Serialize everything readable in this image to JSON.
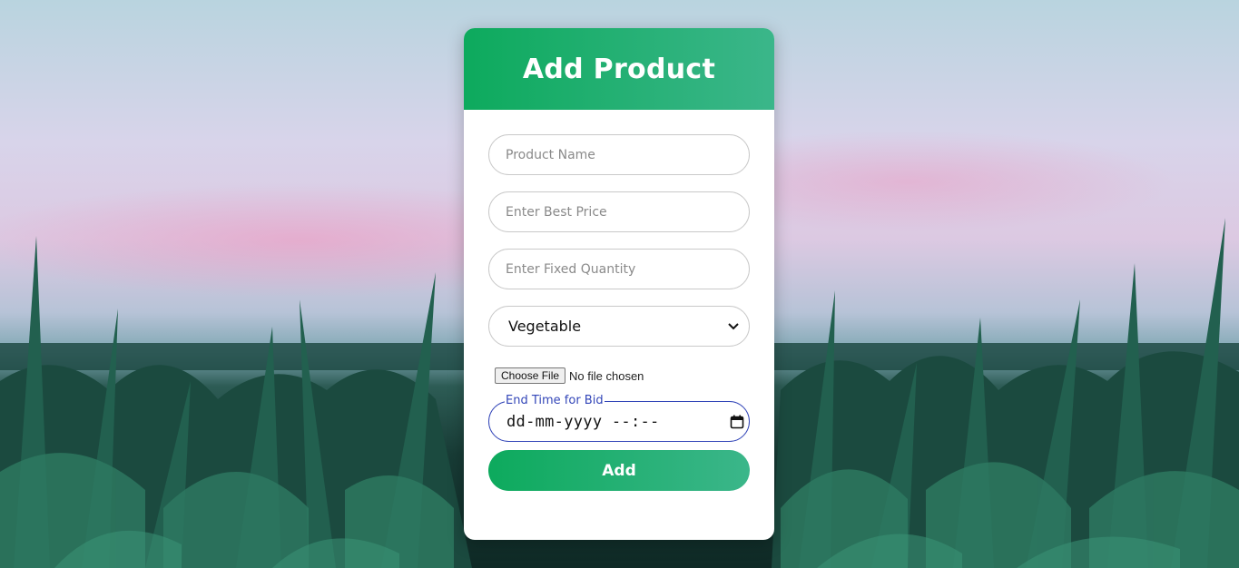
{
  "form": {
    "title": "Add Product",
    "product_name_placeholder": "Product Name",
    "best_price_placeholder": "Enter Best Price",
    "fixed_quantity_placeholder": "Enter Fixed Quantity",
    "category_selected": "Vegetable",
    "file_button_label": "Choose File",
    "file_status": "No file chosen",
    "end_time_label": "End Time for Bid",
    "end_time_value": "dd-mm-yyyy --:--",
    "submit_label": "Add"
  },
  "colors": {
    "accent_start": "#0daa5d",
    "accent_end": "#3bb68a",
    "focus_border": "#3346b8"
  },
  "icons": {
    "select": "chevron-down-icon",
    "datetime": "calendar-icon"
  }
}
